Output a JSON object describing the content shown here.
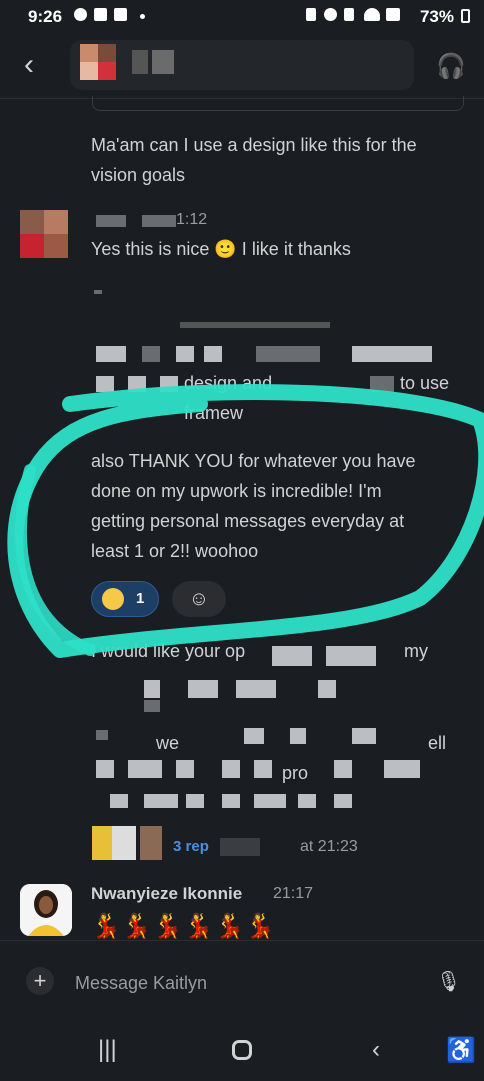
{
  "status_bar": {
    "time": "9:26",
    "battery": "73%"
  },
  "header": {
    "back_icon": "chevron-left-icon",
    "headphones_icon": "headphones-icon"
  },
  "messages": {
    "m1_text_line1": "Ma'am can I use a design like this for the",
    "m1_text_line2": "vision goals",
    "m2_time": "1:12",
    "m2_text": "Yes this is nice 🙂 I like it thanks",
    "m3_fragment1": "design and framew",
    "m3_fragment2": "to use",
    "m4_line1": "also THANK YOU for whatever you have",
    "m4_line2": "done on my upwork is incredible! I'm",
    "m4_line3": "getting personal messages everyday at",
    "m4_line4": "least 1 or 2!! woohoo",
    "reaction_count": "1",
    "m5_fragment1": "I would like your op",
    "m5_fragment2": "my",
    "m5_fragment3": "we",
    "m5_fragment4": "ell",
    "m5_fragment5": "pro",
    "threads_label": "3 rep",
    "threads_time": "at 21:23",
    "m6_name": "Nwanyieze Ikonnie",
    "m6_time": "21:17",
    "m6_emojis": "💃💃💃💃💃💃"
  },
  "composer": {
    "placeholder": "Message Kaitlyn"
  },
  "colors": {
    "background": "#1a1d21",
    "highlight": "#2ee0c8",
    "link": "#4a8fe0"
  }
}
